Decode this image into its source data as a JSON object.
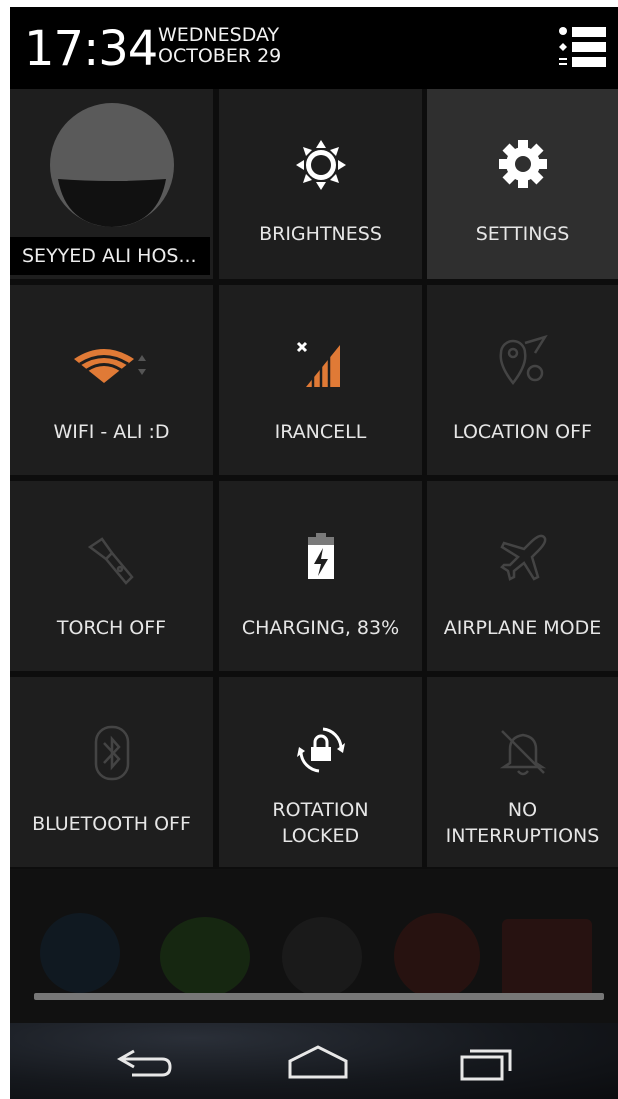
{
  "status": {
    "time": "17:34",
    "day": "WEDNESDAY",
    "date": "OCTOBER 29"
  },
  "user": {
    "name": "SEYYED ALI HOS..."
  },
  "tiles": [
    {
      "label": "BRIGHTNESS",
      "icon": "brightness-icon"
    },
    {
      "label": "SETTINGS",
      "icon": "gear-icon"
    },
    {
      "label": "WIFI - ALI :D",
      "icon": "wifi-icon"
    },
    {
      "label": "IRANCELL",
      "icon": "signal-icon"
    },
    {
      "label": "LOCATION OFF",
      "icon": "location-off-icon"
    },
    {
      "label": "TORCH OFF",
      "icon": "torch-icon"
    },
    {
      "label": "CHARGING, 83%",
      "icon": "battery-charging-icon"
    },
    {
      "label": "AIRPLANE MODE",
      "icon": "airplane-icon"
    },
    {
      "label": "BLUETOOTH OFF",
      "icon": "bluetooth-icon"
    },
    {
      "label_line1": "ROTATION",
      "label_line2": "LOCKED",
      "icon": "rotation-lock-icon"
    },
    {
      "label_line1": "NO",
      "label_line2": "INTERRUPTIONS",
      "icon": "bell-off-icon"
    }
  ],
  "colors": {
    "accent_orange": "#e07a36",
    "tile_bg": "#1e1e1e",
    "tile_active_bg": "#2f2f2f",
    "dim_icon": "#3e3e3e"
  },
  "nav": {
    "back": "back-icon",
    "home": "home-icon",
    "recents": "recents-icon"
  }
}
